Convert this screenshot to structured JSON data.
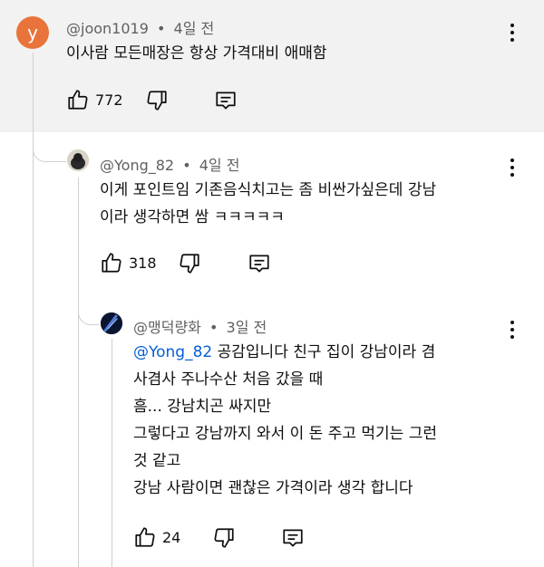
{
  "comments": [
    {
      "avatar_letter": "y",
      "avatar_color": "#e8743b",
      "author": "@joon1019",
      "time": "4일 전",
      "text_lines": [
        "이사람 모든매장은 항상 가격대비 애매함"
      ],
      "like_count": "772",
      "icons": {
        "like": "thumbs-up-icon",
        "dislike": "thumbs-down-icon",
        "reply": "reply-icon",
        "more": "more-vert-icon"
      }
    },
    {
      "author": "@Yong_82",
      "time": "4일 전",
      "text_lines": [
        "이게 포인트임 기존음식치고는 좀 비싼가싶은데 강남",
        "이라 생각하면 쌈 ㅋㅋㅋㅋㅋ"
      ],
      "like_count": "318"
    },
    {
      "author": "@맹덕량화",
      "time": "3일 전",
      "mention": "@Yong_82",
      "first_line_rest": " 공감입니다 친구 집이 강남이라 겸",
      "text_lines": [
        "사겸사 주나수산 처음 갔을 때",
        "흠... 강남치곤 싸지만",
        "그렇다고 강남까지 와서 이 돈 주고 먹기는 그런",
        "것 같고",
        "강남 사람이면 괜찮은 가격이라 생각 합니다"
      ],
      "like_count": "24"
    }
  ],
  "colors": {
    "highlight_bg": "#f2f2f2",
    "mention": "#065fd4",
    "meta": "#606060"
  }
}
